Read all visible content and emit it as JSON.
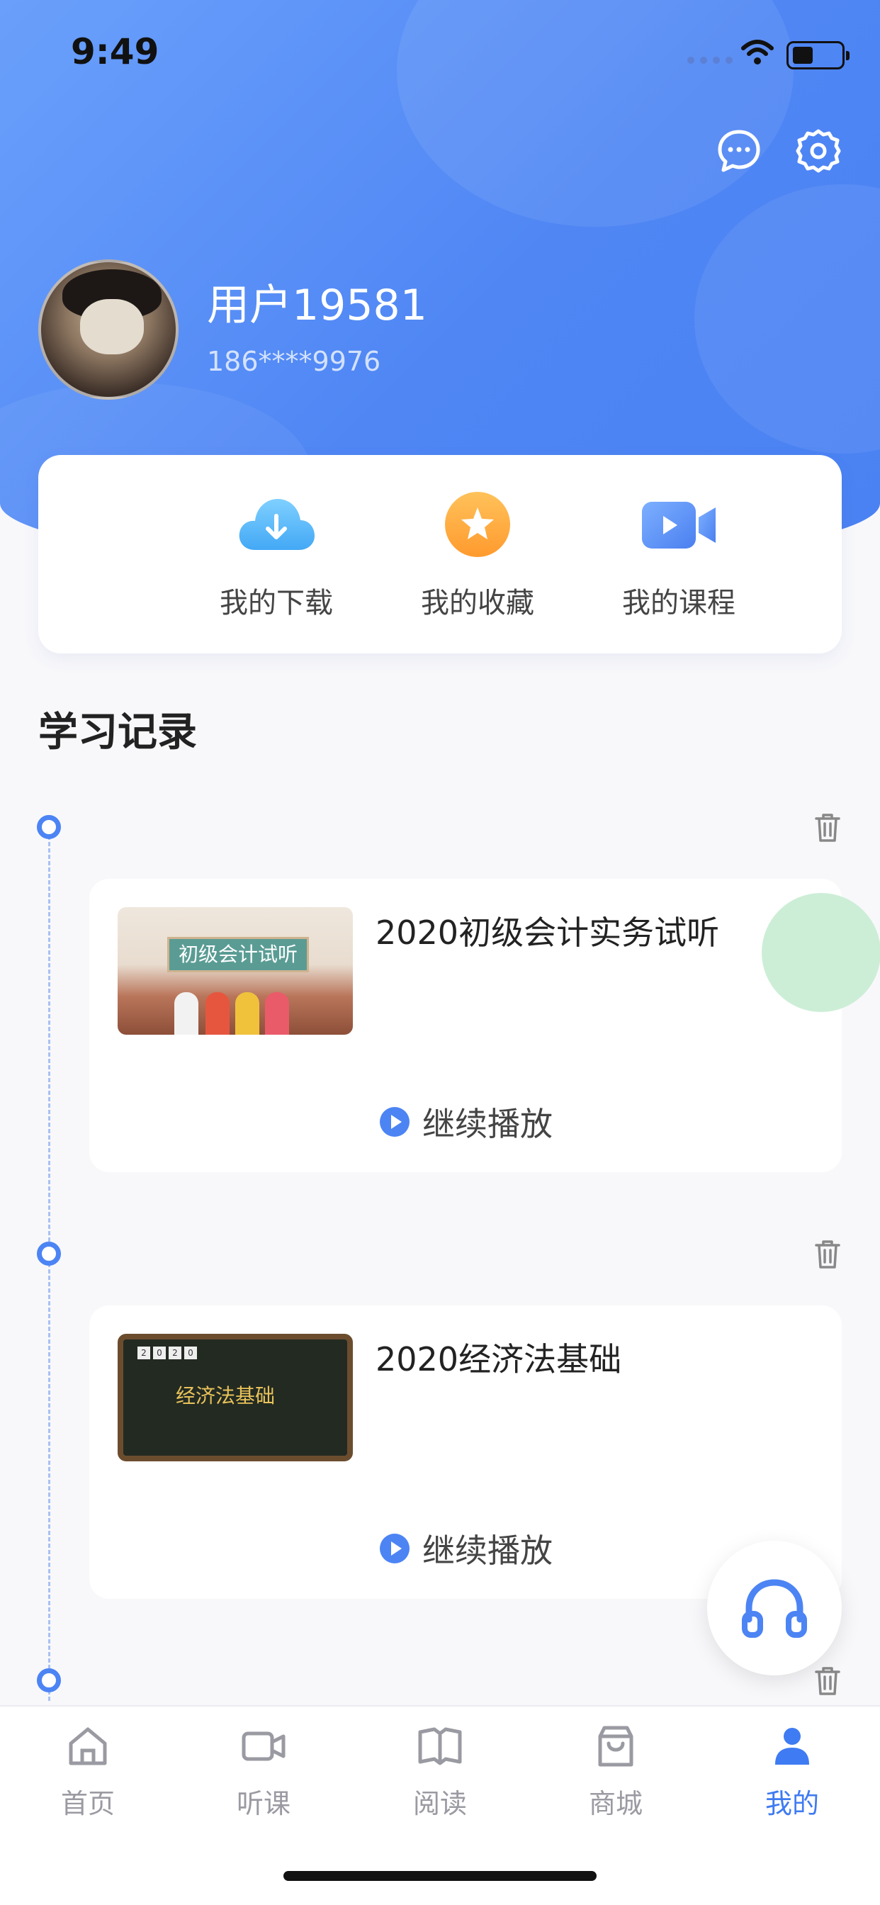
{
  "status": {
    "time": "9:49"
  },
  "profile": {
    "username": "用户19581",
    "phone": "186****9976"
  },
  "quick_links": [
    {
      "label": "我的下载",
      "icon": "cloud-download-icon"
    },
    {
      "label": "我的收藏",
      "icon": "star-icon"
    },
    {
      "label": "我的课程",
      "icon": "video-camera-icon"
    }
  ],
  "section": {
    "title": "学习记录"
  },
  "records": [
    {
      "title": "2020初级会计实务试听",
      "thumb_text": "初级会计试听",
      "action": "继续播放"
    },
    {
      "title": "2020经济法基础",
      "thumb_text": "经济法基础",
      "action": "继续播放"
    }
  ],
  "tabs": [
    {
      "label": "首页",
      "icon": "home-icon"
    },
    {
      "label": "听课",
      "icon": "video-icon"
    },
    {
      "label": "阅读",
      "icon": "book-icon"
    },
    {
      "label": "商城",
      "icon": "shop-bag-icon"
    },
    {
      "label": "我的",
      "icon": "profile-icon",
      "active": true
    }
  ],
  "colors": {
    "accent": "#4c84f4",
    "header_gradient_start": "#6aa0fb",
    "header_gradient_end": "#4a82f3",
    "tab_inactive": "#9a9aa2"
  }
}
